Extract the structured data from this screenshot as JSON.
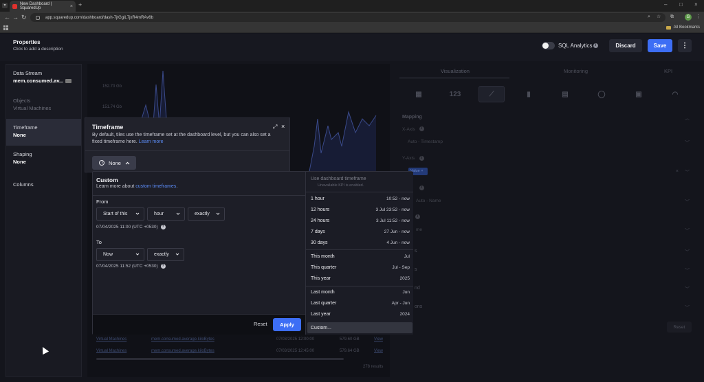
{
  "browser": {
    "tab_title": "New Dashboard | SquaredUp",
    "url": "app.squaredup.com/dashboard/dash-7jtGgiL7jxR4mRAv6b",
    "bookmarks_label": "All Bookmarks",
    "profile_initial": "G"
  },
  "header": {
    "title": "Properties",
    "subtitle": "Click to add a description",
    "sql_label": "SQL Analytics",
    "discard": "Discard",
    "save": "Save"
  },
  "left_panel": {
    "items": [
      {
        "label": "Data Stream",
        "value": "mem.consumed.av..."
      },
      {
        "label": "Objects",
        "value": "Virtual Machines"
      },
      {
        "label": "Timeframe",
        "value": "None"
      },
      {
        "label": "Shaping",
        "value": "None"
      },
      {
        "label": "Columns",
        "value": ""
      }
    ]
  },
  "chart": {
    "y_ticks": [
      "152.70 Gb",
      "151.74 Gb"
    ],
    "color": "#3a4a8a"
  },
  "table": {
    "rows": [
      {
        "object": "Virtual Machines",
        "metric": "mem.consumed.average.kiloBytes",
        "time": "07/03/2025 12:00:00",
        "value": "579.60 GB",
        "link": "View"
      },
      {
        "object": "Virtual Machines",
        "metric": "mem.consumed.average.kiloBytes",
        "time": "07/03/2025 12:45:00",
        "value": "579.64 GB",
        "link": "View"
      }
    ],
    "results": "278 results"
  },
  "right_panel": {
    "tabs": [
      "Visualization",
      "Monitoring",
      "KPI"
    ],
    "viz_tiles": [
      "table",
      "123",
      "line",
      "bar",
      "blocks",
      "donut",
      "scalar",
      "gauge"
    ],
    "mapping_label": "Mapping",
    "xaxis_label": "X-Axis",
    "xaxis_value": "Auto - Timestamp",
    "yaxis_label": "Y-Axis",
    "yaxis_chip": "Value",
    "series_value": "Auto - Name",
    "series_partial": "me",
    "collapsed_partials": [
      "s",
      "s",
      "nd",
      "ons"
    ],
    "reset": "Reset"
  },
  "timeframe": {
    "title": "Timeframe",
    "desc_prefix": "By default, tiles use the timeframe set at the dashboard level, but you can also set a fixed timeframe here. ",
    "desc_link": "Learn more",
    "current": "None"
  },
  "custom": {
    "title": "Custom",
    "sub_prefix": "Learn more about ",
    "sub_link": "custom timeframes",
    "sub_suffix": ".",
    "from_label": "From",
    "from_selects": [
      "Start of this",
      "hour",
      "exactly"
    ],
    "from_ts": "07/04/2025 11:00 (UTC +0530)",
    "to_label": "To",
    "to_selects": [
      "Now",
      "exactly"
    ],
    "to_ts": "07/04/2025 11:52 (UTC +0530)",
    "reset": "Reset",
    "apply": "Apply"
  },
  "presets": {
    "use_dashboard": "Use dashboard timeframe",
    "use_dashboard_sub": "Unavailable KPI is enabled.",
    "groups": [
      [
        {
          "label": "1 hour",
          "range": "10:52 - now"
        },
        {
          "label": "12 hours",
          "range": "3 Jul 23:52 - now"
        },
        {
          "label": "24 hours",
          "range": "3 Jul 11:52 - now"
        },
        {
          "label": "7 days",
          "range": "27 Jun - now"
        },
        {
          "label": "30 days",
          "range": "4 Jun - now"
        }
      ],
      [
        {
          "label": "This month",
          "range": "Jul"
        },
        {
          "label": "This quarter",
          "range": "Jul - Sep"
        },
        {
          "label": "This year",
          "range": "2025"
        }
      ],
      [
        {
          "label": "Last month",
          "range": "Jun"
        },
        {
          "label": "Last quarter",
          "range": "Apr - Jun"
        },
        {
          "label": "Last year",
          "range": "2024"
        }
      ]
    ],
    "custom": "Custom..."
  }
}
